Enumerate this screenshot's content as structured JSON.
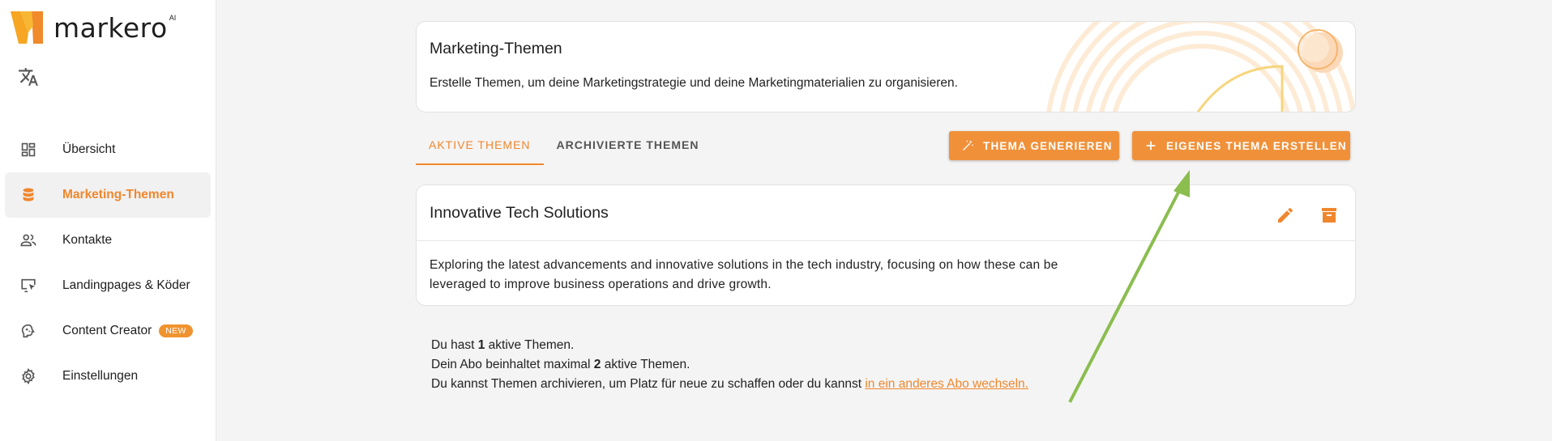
{
  "app": {
    "logo_text": "markero",
    "logo_suffix": "AI"
  },
  "sidebar": {
    "items": [
      {
        "label": "Übersicht",
        "icon": "dashboard-icon"
      },
      {
        "label": "Marketing-Themen",
        "icon": "database-icon",
        "active": true
      },
      {
        "label": "Kontakte",
        "icon": "people-icon"
      },
      {
        "label": "Landingpages & Köder",
        "icon": "screen-pointer-icon"
      },
      {
        "label": "Content Creator",
        "icon": "brain-icon",
        "badge": "NEW"
      },
      {
        "label": "Einstellungen",
        "icon": "gear-icon"
      }
    ]
  },
  "header": {
    "title": "Marketing-Themen",
    "description": "Erstelle Themen, um deine Marketingstrategie und deine Marketingmaterialien zu organisieren."
  },
  "tabs": [
    {
      "label": "AKTIVE THEMEN",
      "active": true
    },
    {
      "label": "ARCHIVIERTE THEMEN",
      "active": false
    }
  ],
  "buttons": {
    "generate": "THEMA GENERIEREN",
    "create_own": "EIGENES THEMA ERSTELLEN"
  },
  "theme": {
    "title": "Innovative Tech Solutions",
    "description": "Exploring the latest advancements and innovative solutions in the tech industry, focusing on how these can be leveraged to improve business operations and drive growth."
  },
  "info": {
    "line1_pre": "Du hast ",
    "line1_count": "1",
    "line1_post": " aktive Themen.",
    "line2_pre": "Dein Abo beinhaltet maximal ",
    "line2_count": "2",
    "line2_post": " aktive Themen.",
    "line3_text": "Du kannst Themen archivieren, um Platz für neue zu schaffen oder du kannst ",
    "line3_link": "in ein anderes Abo wechseln."
  },
  "colors": {
    "accent": "#f0872d",
    "button": "#f0913a",
    "annotation_arrow": "#8bbd4f"
  }
}
